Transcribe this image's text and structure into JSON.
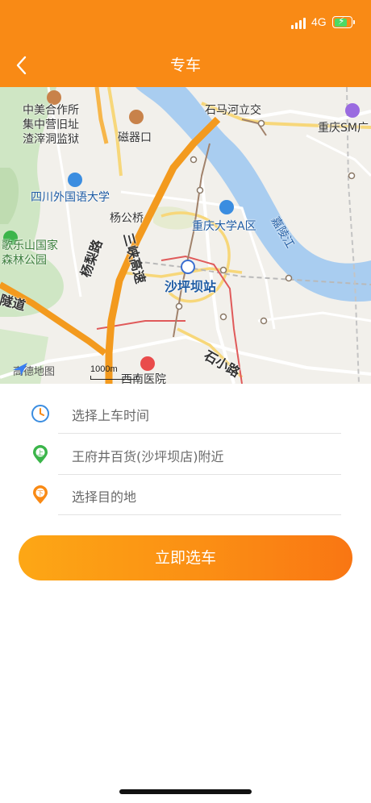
{
  "status_bar": {
    "network": "4G",
    "battery_level": 0.6,
    "charging": true
  },
  "header": {
    "title": "专车",
    "back_icon": "chevron-left-icon",
    "bg_color": "#f98a15"
  },
  "map": {
    "labels": {
      "prison": "中美合作所\n集中营旧址\n渣滓洞监狱",
      "ciqikou": "磁器口",
      "shimahe": "石马河立交",
      "chongqing_sm": "重庆SM广",
      "sisu": "四川外国语大学",
      "yanggongqiao": "杨公桥",
      "cqu": "重庆大学A区",
      "jialing": "嘉陵江",
      "gelesan": "歌乐山国家\n森林公园",
      "yangli_road": "杨梨路",
      "sanxia_expressway": "三峡高速",
      "shapingba_station": "沙坪坝站",
      "tunnel_road": "隧道",
      "shixiao_road": "石小路",
      "southwest_hospital": "西南医院"
    },
    "logo_text": "高德地图",
    "scale_text": "1000m"
  },
  "form": {
    "time_placeholder": "选择上车时间",
    "pickup_value": "王府井百货(沙坪坝店)附近",
    "pickup_badge": "上",
    "dest_placeholder": "选择目的地",
    "dest_badge": "下"
  },
  "cta_label": "立即选车",
  "colors": {
    "accent": "#f98a15",
    "pickup_green": "#3bb54a",
    "dest_orange": "#f98a15",
    "time_blue": "#3b8de0"
  }
}
